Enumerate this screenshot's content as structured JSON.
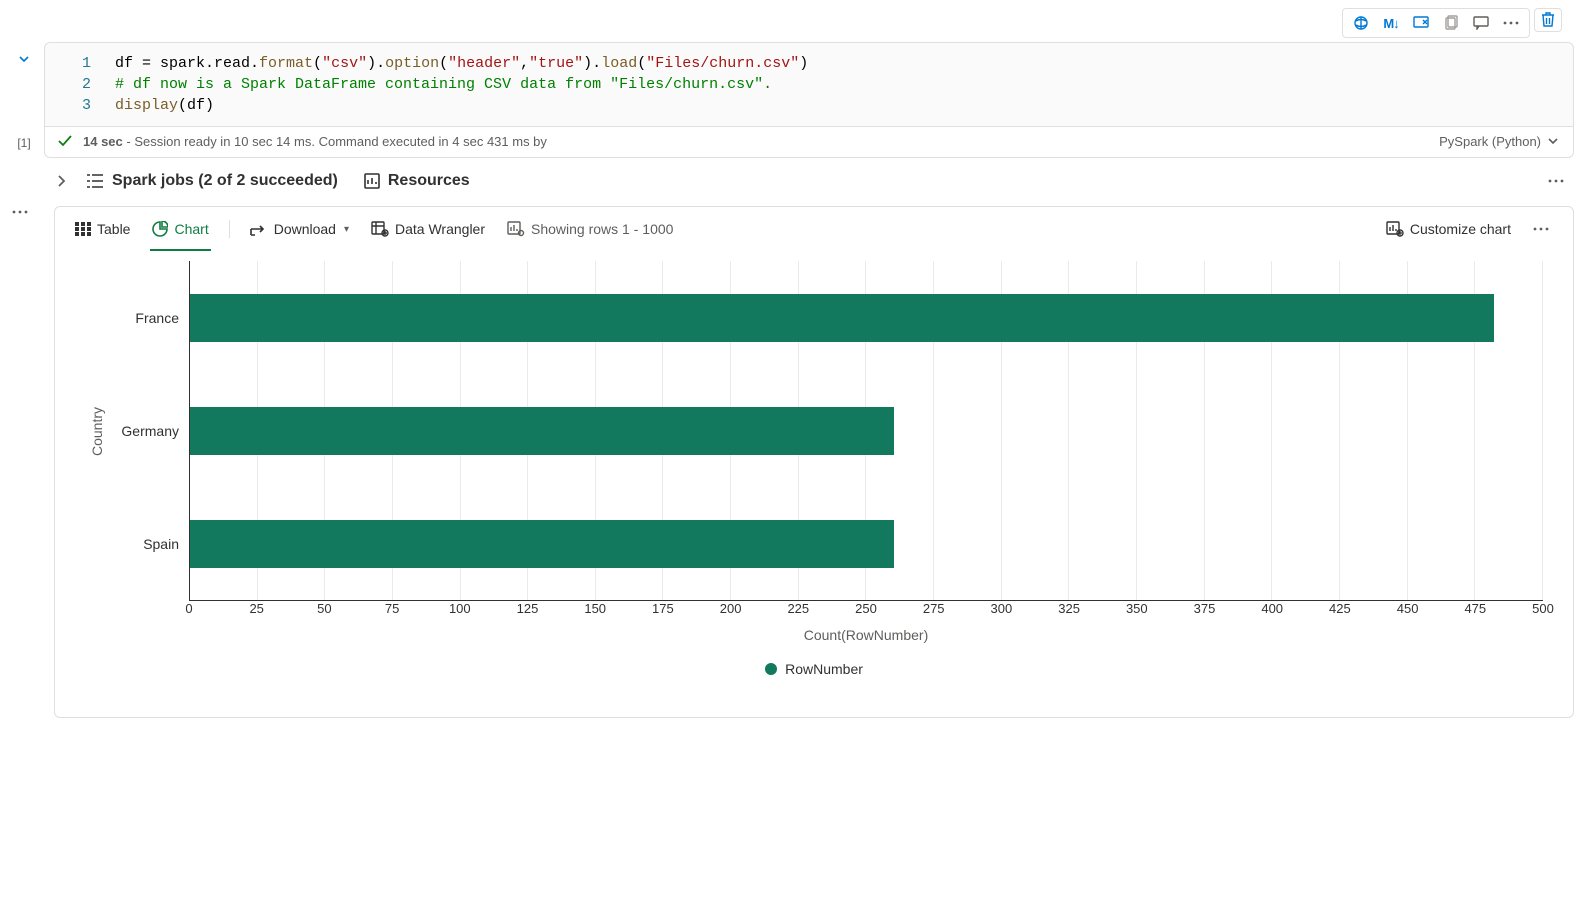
{
  "toolbar": {
    "md_label": "M↓"
  },
  "cell": {
    "exec_count": "[1]",
    "language": "PySpark (Python)",
    "status_time": "14 sec",
    "status_msg": " - Session ready in 10 sec 14 ms. Command executed in 4 sec 431 ms by",
    "code": {
      "l1_num": "1",
      "l2_num": "2",
      "l3_num": "3",
      "l1_a": "df = spark.read.",
      "l1_fn1": "format",
      "l1_b": "(",
      "l1_s1": "\"csv\"",
      "l1_c": ").",
      "l1_fn2": "option",
      "l1_d": "(",
      "l1_s2": "\"header\"",
      "l1_e": ",",
      "l1_s3": "\"true\"",
      "l1_f": ").",
      "l1_fn3": "load",
      "l1_g": "(",
      "l1_s4": "\"Files/churn.csv\"",
      "l1_h": ")",
      "l2": "# df now is a Spark DataFrame containing CSV data from \"Files/churn.csv\".",
      "l3_fn": "display",
      "l3_b": "(df)"
    }
  },
  "jobs": {
    "label": "Spark jobs (2 of 2 succeeded)",
    "resources": "Resources"
  },
  "result_tabs": {
    "table": "Table",
    "chart": "Chart",
    "download": "Download",
    "wrangler": "Data Wrangler",
    "rows": "Showing rows 1 - 1000",
    "customize": "Customize chart"
  },
  "chart_data": {
    "type": "bar",
    "orientation": "horizontal",
    "categories": [
      "France",
      "Germany",
      "Spain"
    ],
    "values": [
      482,
      260,
      260
    ],
    "xlabel": "Count(RowNumber)",
    "ylabel": "Country",
    "xlim_max": 500,
    "xticks": [
      0,
      25,
      50,
      75,
      100,
      125,
      150,
      175,
      200,
      225,
      250,
      275,
      300,
      325,
      350,
      375,
      400,
      425,
      450,
      475,
      500
    ],
    "series_name": "RowNumber",
    "color": "#12795f"
  },
  "xtick_labels": {
    "t0": "0",
    "t25": "25",
    "t50": "50",
    "t75": "75",
    "t100": "100",
    "t125": "125",
    "t150": "150",
    "t175": "175",
    "t200": "200",
    "t225": "225",
    "t250": "250",
    "t275": "275",
    "t300": "300",
    "t325": "325",
    "t350": "350",
    "t375": "375",
    "t400": "400",
    "t425": "425",
    "t450": "450",
    "t475": "475",
    "t500": "500"
  }
}
